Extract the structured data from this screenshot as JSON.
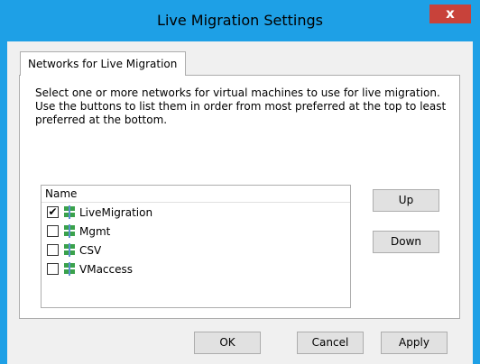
{
  "window": {
    "title": "Live Migration Settings",
    "close_glyph": "x"
  },
  "tab": {
    "label": "Networks for Live Migration"
  },
  "description": "Select one or more networks for virtual machines to use for live migration. Use the buttons to list them in order from most preferred at the top to least preferred at the bottom.",
  "list": {
    "header": "Name",
    "items": [
      {
        "label": "LiveMigration",
        "checked": true
      },
      {
        "label": "Mgmt",
        "checked": false
      },
      {
        "label": "CSV",
        "checked": false
      },
      {
        "label": "VMaccess",
        "checked": false
      }
    ]
  },
  "side_buttons": {
    "up": "Up",
    "down": "Down"
  },
  "footer": {
    "ok": "OK",
    "cancel": "Cancel",
    "apply": "Apply"
  },
  "colors": {
    "titlebar": "#1ea0e6",
    "close": "#c8423a",
    "network_icon": "#3aa24c"
  }
}
